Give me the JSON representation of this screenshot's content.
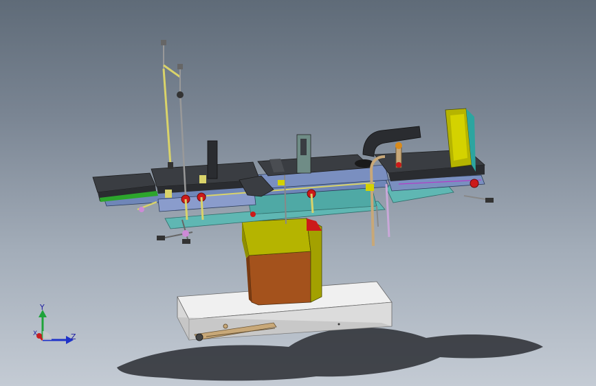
{
  "viewport": {
    "model": "operating-table-assembly",
    "background_top": "#5f6b78",
    "background_bottom": "#c4cbd4"
  },
  "triad": {
    "y_label": "Y",
    "x_label": "X",
    "z_label": "Z",
    "y_color": "#1fa33a",
    "x_color": "#c81e1e",
    "z_color": "#1e32c8"
  },
  "colors": {
    "cushion": "#3a3d42",
    "rail_blue": "#6f86b8",
    "frame_teal": "#5fb7b3",
    "column_olive": "#b5b400",
    "column_brown": "#a4521c",
    "base_white": "#e6e6e6",
    "knob_red": "#cc1a1a",
    "rod_yellow": "#d9d36a",
    "accent_green": "#2ca52c",
    "pedal_tan": "#c8a878"
  }
}
